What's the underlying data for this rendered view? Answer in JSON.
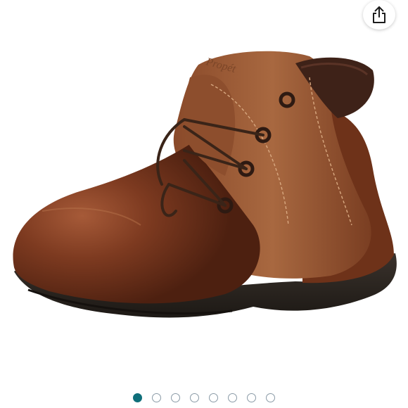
{
  "product": {
    "brand_mark": "Propét"
  },
  "share": {
    "icon": "share-icon"
  },
  "carousel": {
    "total": 8,
    "active_index": 0
  },
  "colors": {
    "leather": "#7a3a1e",
    "sole": "#2a2420",
    "collar": "#3e2218",
    "active_dot": "#0f6f7a",
    "inactive_dot_border": "#8a9aa6"
  }
}
